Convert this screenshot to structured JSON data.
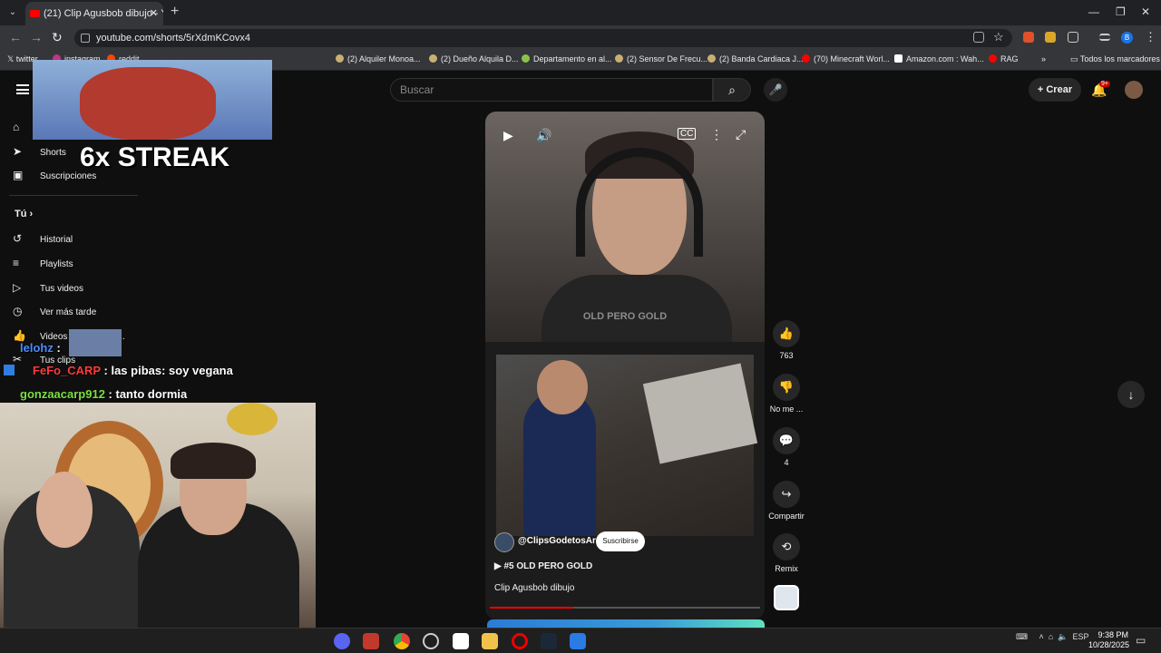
{
  "browser": {
    "tab_title": "(21) Clip Agusbob dibujo - You",
    "url": "youtube.com/shorts/5rXdmKCovx4",
    "bookmarks": [
      "twitter",
      "instagram",
      "reddit",
      "(2) Alquiler Monoa...",
      "(2) Dueño Alquila D...",
      "Departamento en al...",
      "(2) Sensor De Frecu...",
      "(2) Banda Cardiaca J...",
      "(70) Minecraft Worl...",
      "Amazon.com : Wah...",
      "RAG"
    ],
    "all_bookmarks": "Todos los marcadores",
    "profile_initial": "B"
  },
  "youtube": {
    "search_placeholder": "Buscar",
    "create_label": "Crear",
    "notifications_badge": "9+",
    "sidebar": {
      "shorts": "Shorts",
      "subscriptions": "Suscripciones",
      "you": "Tú",
      "history": "Historial",
      "playlists": "Playlists",
      "your_videos": "Tus videos",
      "watch_later": "Ver más tarde",
      "liked": "Videos que me gus...",
      "clips": "Tus clips"
    },
    "short": {
      "watermark": "OLD PERO GOLD",
      "channel": "@ClipsGodetosArg",
      "subscribe": "Suscribirse",
      "playlist": "#5 OLD PERO GOLD",
      "title": "Clip Agusbob dibujo",
      "progress_fraction": 0.31
    },
    "actions": {
      "likes": "763",
      "dislike": "No me ...",
      "comments": "4",
      "share": "Compartir",
      "remix": "Remix"
    }
  },
  "stream_overlay": {
    "streak": "6x STREAK",
    "chat": [
      {
        "user": "lelohz",
        "sep": " : ",
        "msg": "",
        "color": "#4a8cff"
      },
      {
        "user": "FeFo_CARP",
        "sep": " : ",
        "msg": "las pibas: soy vegana",
        "color": "#ff3b3b"
      },
      {
        "user": "gonzaacarp912",
        "sep": " : ",
        "msg": "tanto dormia",
        "color": "#7be042"
      }
    ]
  },
  "taskbar": {
    "language": "ESP",
    "time": "9:38 PM",
    "date": "10/28/2025"
  }
}
